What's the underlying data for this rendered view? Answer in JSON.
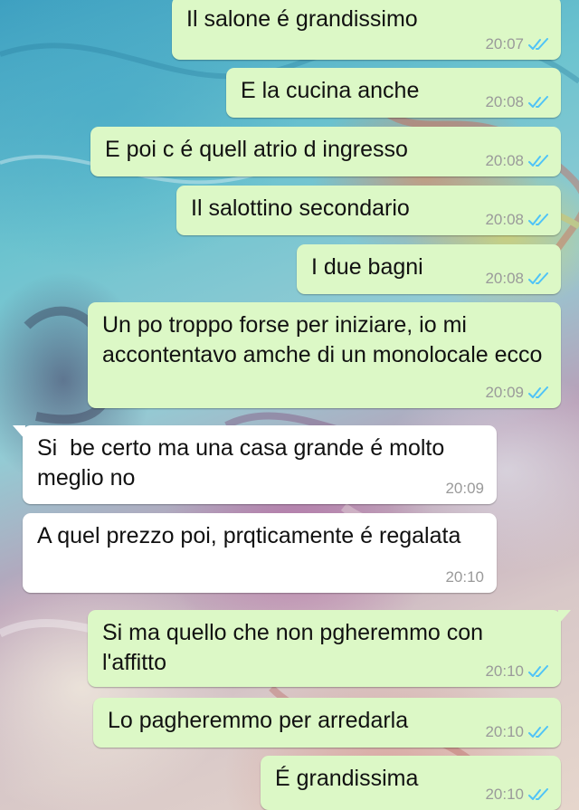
{
  "conversation": {
    "messages": [
      {
        "direction": "out",
        "text": "Il salone é grandissimo",
        "time": "20:07",
        "status": "read"
      },
      {
        "direction": "out",
        "text": "E la cucina anche",
        "time": "20:08",
        "status": "read"
      },
      {
        "direction": "out",
        "text": "E poi c é quell atrio d ingresso",
        "time": "20:08",
        "status": "read"
      },
      {
        "direction": "out",
        "text": "Il salottino secondario",
        "time": "20:08",
        "status": "read"
      },
      {
        "direction": "out",
        "text": "I due bagni",
        "time": "20:08",
        "status": "read"
      },
      {
        "direction": "out",
        "text": "Un po troppo forse per iniziare, io mi accontentavo amche di un monolocale ecco",
        "time": "20:09",
        "status": "read"
      },
      {
        "direction": "in",
        "text": "Si  be certo ma una casa grande é molto meglio no",
        "time": "20:09"
      },
      {
        "direction": "in",
        "text": "A quel prezzo poi, prqticamente é regalata",
        "time": "20:10"
      },
      {
        "direction": "out",
        "text": "Si ma quello che non pgheremmo con l'affitto",
        "time": "20:10",
        "status": "read"
      },
      {
        "direction": "out",
        "text": "Lo pagheremmo per arredarla",
        "time": "20:10",
        "status": "read"
      },
      {
        "direction": "out",
        "text": "É grandissima",
        "time": "20:10",
        "status": "read"
      }
    ]
  },
  "colors": {
    "outgoing_bubble": "#dcf8c6",
    "incoming_bubble": "#ffffff",
    "read_tick": "#4fc3f7",
    "timestamp": "#9a9a9a"
  },
  "icons": {
    "read_status": "double-check-icon"
  }
}
